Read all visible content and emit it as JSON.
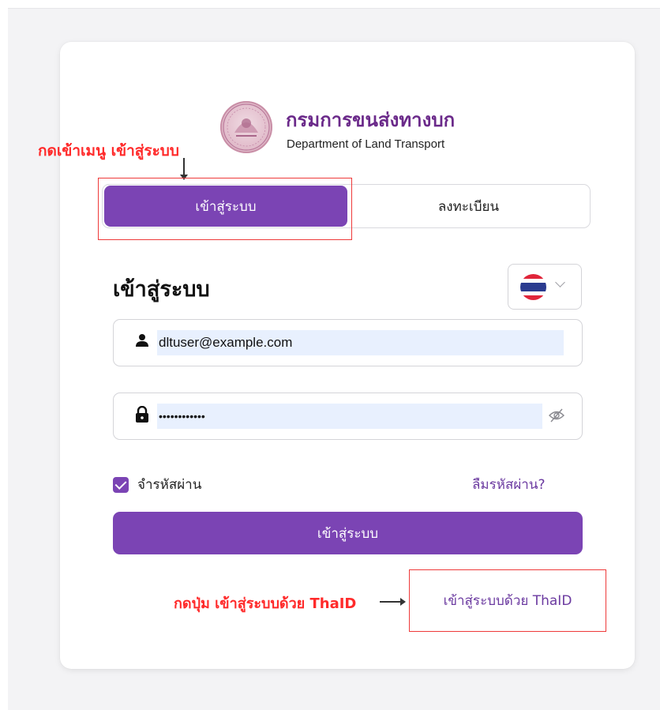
{
  "header": {
    "title": "กรมการขนส่งทางบก",
    "subtitle": "Department of Land Transport",
    "logo_icon": "dlt-seal-icon"
  },
  "annotations": {
    "menu_hint": "กดเข้าเมนู เข้าสู่ระบบ",
    "thaid_hint": "กดปุ่ม เข้าสู่ระบบด้วย ThaID",
    "color": "#ff2a2a"
  },
  "tabs": [
    {
      "label": "เข้าสู่ระบบ",
      "active": true
    },
    {
      "label": "ลงทะเบียน",
      "active": false
    }
  ],
  "form": {
    "section_title": "เข้าสู่ระบบ",
    "language": {
      "selected_icon": "thai-flag-icon"
    },
    "email": {
      "value": "dltuser@example.com",
      "icon": "user-icon"
    },
    "password": {
      "value": "••••••••••••",
      "icon": "lock-icon",
      "toggle_icon": "eye-off-icon"
    },
    "remember": {
      "label": "จำรหัสผ่าน",
      "checked": true
    },
    "forgot_label": "ลืมรหัสผ่าน?",
    "submit_label": "เข้าสู่ระบบ",
    "thaid_label": "เข้าสู่ระบบด้วย ThaID"
  },
  "colors": {
    "accent": "#7b44b4",
    "brand_title": "#6b2a8a",
    "link": "#6b3aa0",
    "autofill_bg": "#e8f0fe"
  }
}
